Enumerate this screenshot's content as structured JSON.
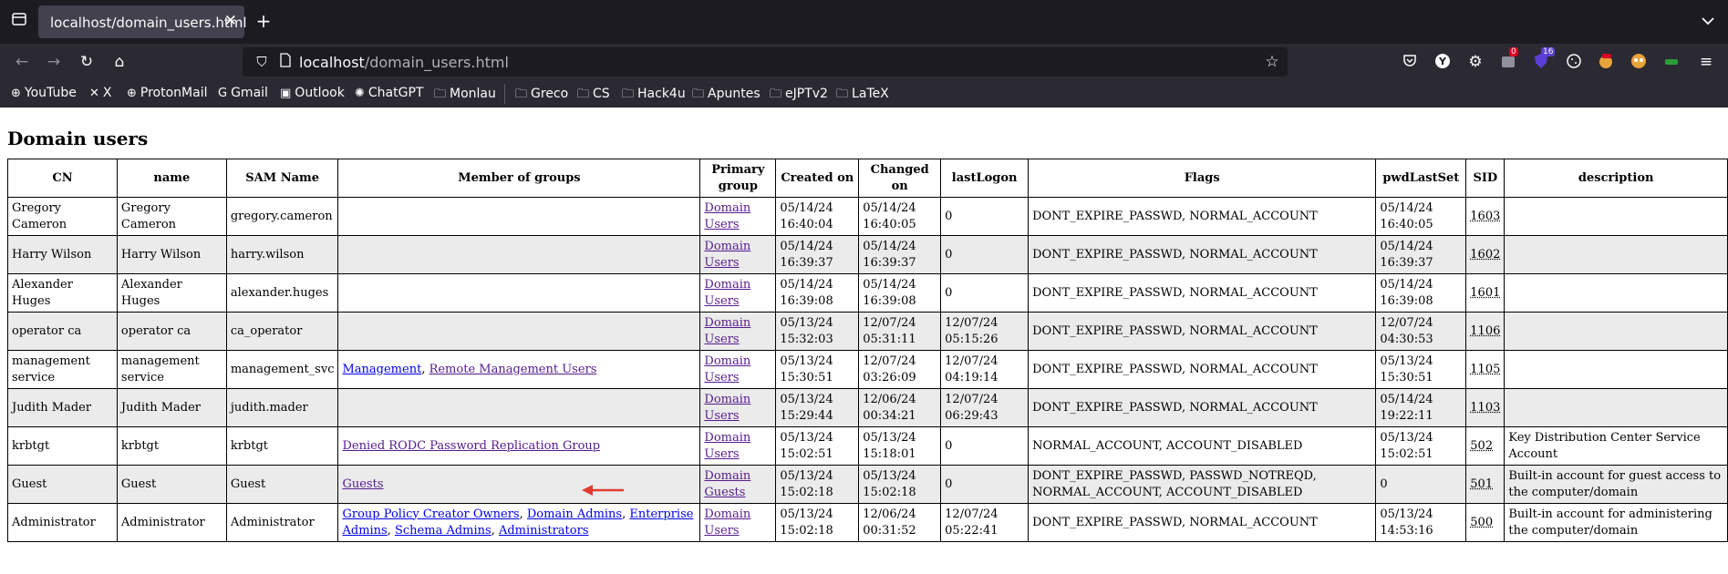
{
  "browser": {
    "tab_title": "localhost/domain_users.html",
    "url_host": "localhost",
    "url_path": "/domain_users.html",
    "badge_counts": [
      "0",
      "16"
    ],
    "bookmarks": [
      "YouTube",
      "X",
      "ProtonMail",
      "Gmail",
      "Outlook",
      "ChatGPT",
      "Monlau",
      "Greco",
      "CS",
      "Hack4u",
      "Apuntes",
      "eJPTv2",
      "LaTeX"
    ]
  },
  "page": {
    "title": "Domain users"
  },
  "table": {
    "headers": [
      "CN",
      "name",
      "SAM Name",
      "Member of groups",
      "Primary group",
      "Created on",
      "Changed on",
      "lastLogon",
      "Flags",
      "pwdLastSet",
      "SID",
      "description"
    ],
    "rows": [
      {
        "cn": "Gregory Cameron",
        "name": "Gregory Cameron",
        "sam": "gregory.cameron",
        "groups": [],
        "primary": "Domain Users",
        "created": "05/14/24 16:40:04",
        "changed": "05/14/24 16:40:05",
        "lastlogon": "0",
        "flags": "DONT_EXPIRE_PASSWD, NORMAL_ACCOUNT",
        "pwdlastset": "05/14/24 16:40:05",
        "sid": "1603",
        "description": ""
      },
      {
        "cn": "Harry Wilson",
        "name": "Harry Wilson",
        "sam": "harry.wilson",
        "groups": [],
        "primary": "Domain Users",
        "created": "05/14/24 16:39:37",
        "changed": "05/14/24 16:39:37",
        "lastlogon": "0",
        "flags": "DONT_EXPIRE_PASSWD, NORMAL_ACCOUNT",
        "pwdlastset": "05/14/24 16:39:37",
        "sid": "1602",
        "description": ""
      },
      {
        "cn": "Alexander Huges",
        "name": "Alexander Huges",
        "sam": "alexander.huges",
        "groups": [],
        "primary": "Domain Users",
        "created": "05/14/24 16:39:08",
        "changed": "05/14/24 16:39:08",
        "lastlogon": "0",
        "flags": "DONT_EXPIRE_PASSWD, NORMAL_ACCOUNT",
        "pwdlastset": "05/14/24 16:39:08",
        "sid": "1601",
        "description": ""
      },
      {
        "cn": "operator ca",
        "name": "operator ca",
        "sam": "ca_operator",
        "groups": [],
        "primary": "Domain Users",
        "created": "05/13/24 15:32:03",
        "changed": "12/07/24 05:31:11",
        "lastlogon": "12/07/24 05:15:26",
        "flags": "DONT_EXPIRE_PASSWD, NORMAL_ACCOUNT",
        "pwdlastset": "12/07/24 04:30:53",
        "sid": "1106",
        "description": ""
      },
      {
        "cn": "management service",
        "name": "management service",
        "sam": "management_svc",
        "groups": [
          "Management",
          "Remote Management Users"
        ],
        "primary": "Domain Users",
        "created": "05/13/24 15:30:51",
        "changed": "12/07/24 03:26:09",
        "lastlogon": "12/07/24 04:19:14",
        "flags": "DONT_EXPIRE_PASSWD, NORMAL_ACCOUNT",
        "pwdlastset": "05/13/24 15:30:51",
        "sid": "1105",
        "description": ""
      },
      {
        "cn": "Judith Mader",
        "name": "Judith Mader",
        "sam": "judith.mader",
        "groups": [],
        "primary": "Domain Users",
        "created": "05/13/24 15:29:44",
        "changed": "12/06/24 00:34:21",
        "lastlogon": "12/07/24 06:29:43",
        "flags": "DONT_EXPIRE_PASSWD, NORMAL_ACCOUNT",
        "pwdlastset": "05/14/24 19:22:11",
        "sid": "1103",
        "description": ""
      },
      {
        "cn": "krbtgt",
        "name": "krbtgt",
        "sam": "krbtgt",
        "groups": [
          "Denied RODC Password Replication Group"
        ],
        "primary": "Domain Users",
        "created": "05/13/24 15:02:51",
        "changed": "05/13/24 15:18:01",
        "lastlogon": "0",
        "flags": "NORMAL_ACCOUNT, ACCOUNT_DISABLED",
        "pwdlastset": "05/13/24 15:02:51",
        "sid": "502",
        "description": "Key Distribution Center Service Account"
      },
      {
        "cn": "Guest",
        "name": "Guest",
        "sam": "Guest",
        "groups": [
          "Guests"
        ],
        "primary": "Domain Guests",
        "created": "05/13/24 15:02:18",
        "changed": "05/13/24 15:02:18",
        "lastlogon": "0",
        "flags": "DONT_EXPIRE_PASSWD, PASSWD_NOTREQD, NORMAL_ACCOUNT, ACCOUNT_DISABLED",
        "pwdlastset": "0",
        "sid": "501",
        "description": "Built-in account for guest access to the computer/domain"
      },
      {
        "cn": "Administrator",
        "name": "Administrator",
        "sam": "Administrator",
        "groups": [
          "Group Policy Creator Owners",
          "Domain Admins",
          "Enterprise Admins",
          "Schema Admins",
          "Administrators"
        ],
        "primary": "Domain Users",
        "created": "05/13/24 15:02:18",
        "changed": "12/06/24 00:31:52",
        "lastlogon": "12/07/24 05:22:41",
        "flags": "DONT_EXPIRE_PASSWD, NORMAL_ACCOUNT",
        "pwdlastset": "05/13/24 14:53:16",
        "sid": "500",
        "description": "Built-in account for administering the computer/domain"
      }
    ]
  },
  "annotation": {
    "arrow_color": "#e03c31"
  }
}
